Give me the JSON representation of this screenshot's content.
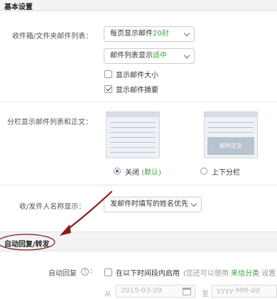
{
  "basic_settings": {
    "title": "基本设置",
    "list_row": {
      "label": "收件箱/文件夹邮件列表：",
      "per_page_prefix": "每页显示邮件",
      "per_page_value": "20封",
      "display_prefix": "邮件列表显示",
      "display_value": "适中",
      "show_size_label": "显示邮件大小",
      "show_size_checked": false,
      "show_summary_label": "显示邮件摘要",
      "show_summary_checked": true
    },
    "split_row": {
      "label": "分栏显示邮件列表和正文：",
      "preview_pane_text": "邮件正文",
      "option_off_label": "关闭",
      "option_off_note": "(默认)",
      "option_split_label": "上下分栏",
      "selected": "off"
    },
    "sender_row": {
      "label": "收/发件人名称显示：",
      "value": "发邮件时填写的姓名优先"
    }
  },
  "auto_reply": {
    "title": "自动回复/转发",
    "reply_label": "自动回复",
    "help_icon": "?",
    "enable_label": "在以下时间段内启用",
    "hint_prefix": "(您还可以使用",
    "hint_link": "来信分类",
    "hint_suffix": "设置自",
    "from_label": "从",
    "from_date": "2015-03-09",
    "to_label": "至",
    "to_date": "yyyy-MM-dd"
  },
  "colors": {
    "accent_green": "#3aa33a",
    "annotation_red": "#8b1a1a"
  }
}
